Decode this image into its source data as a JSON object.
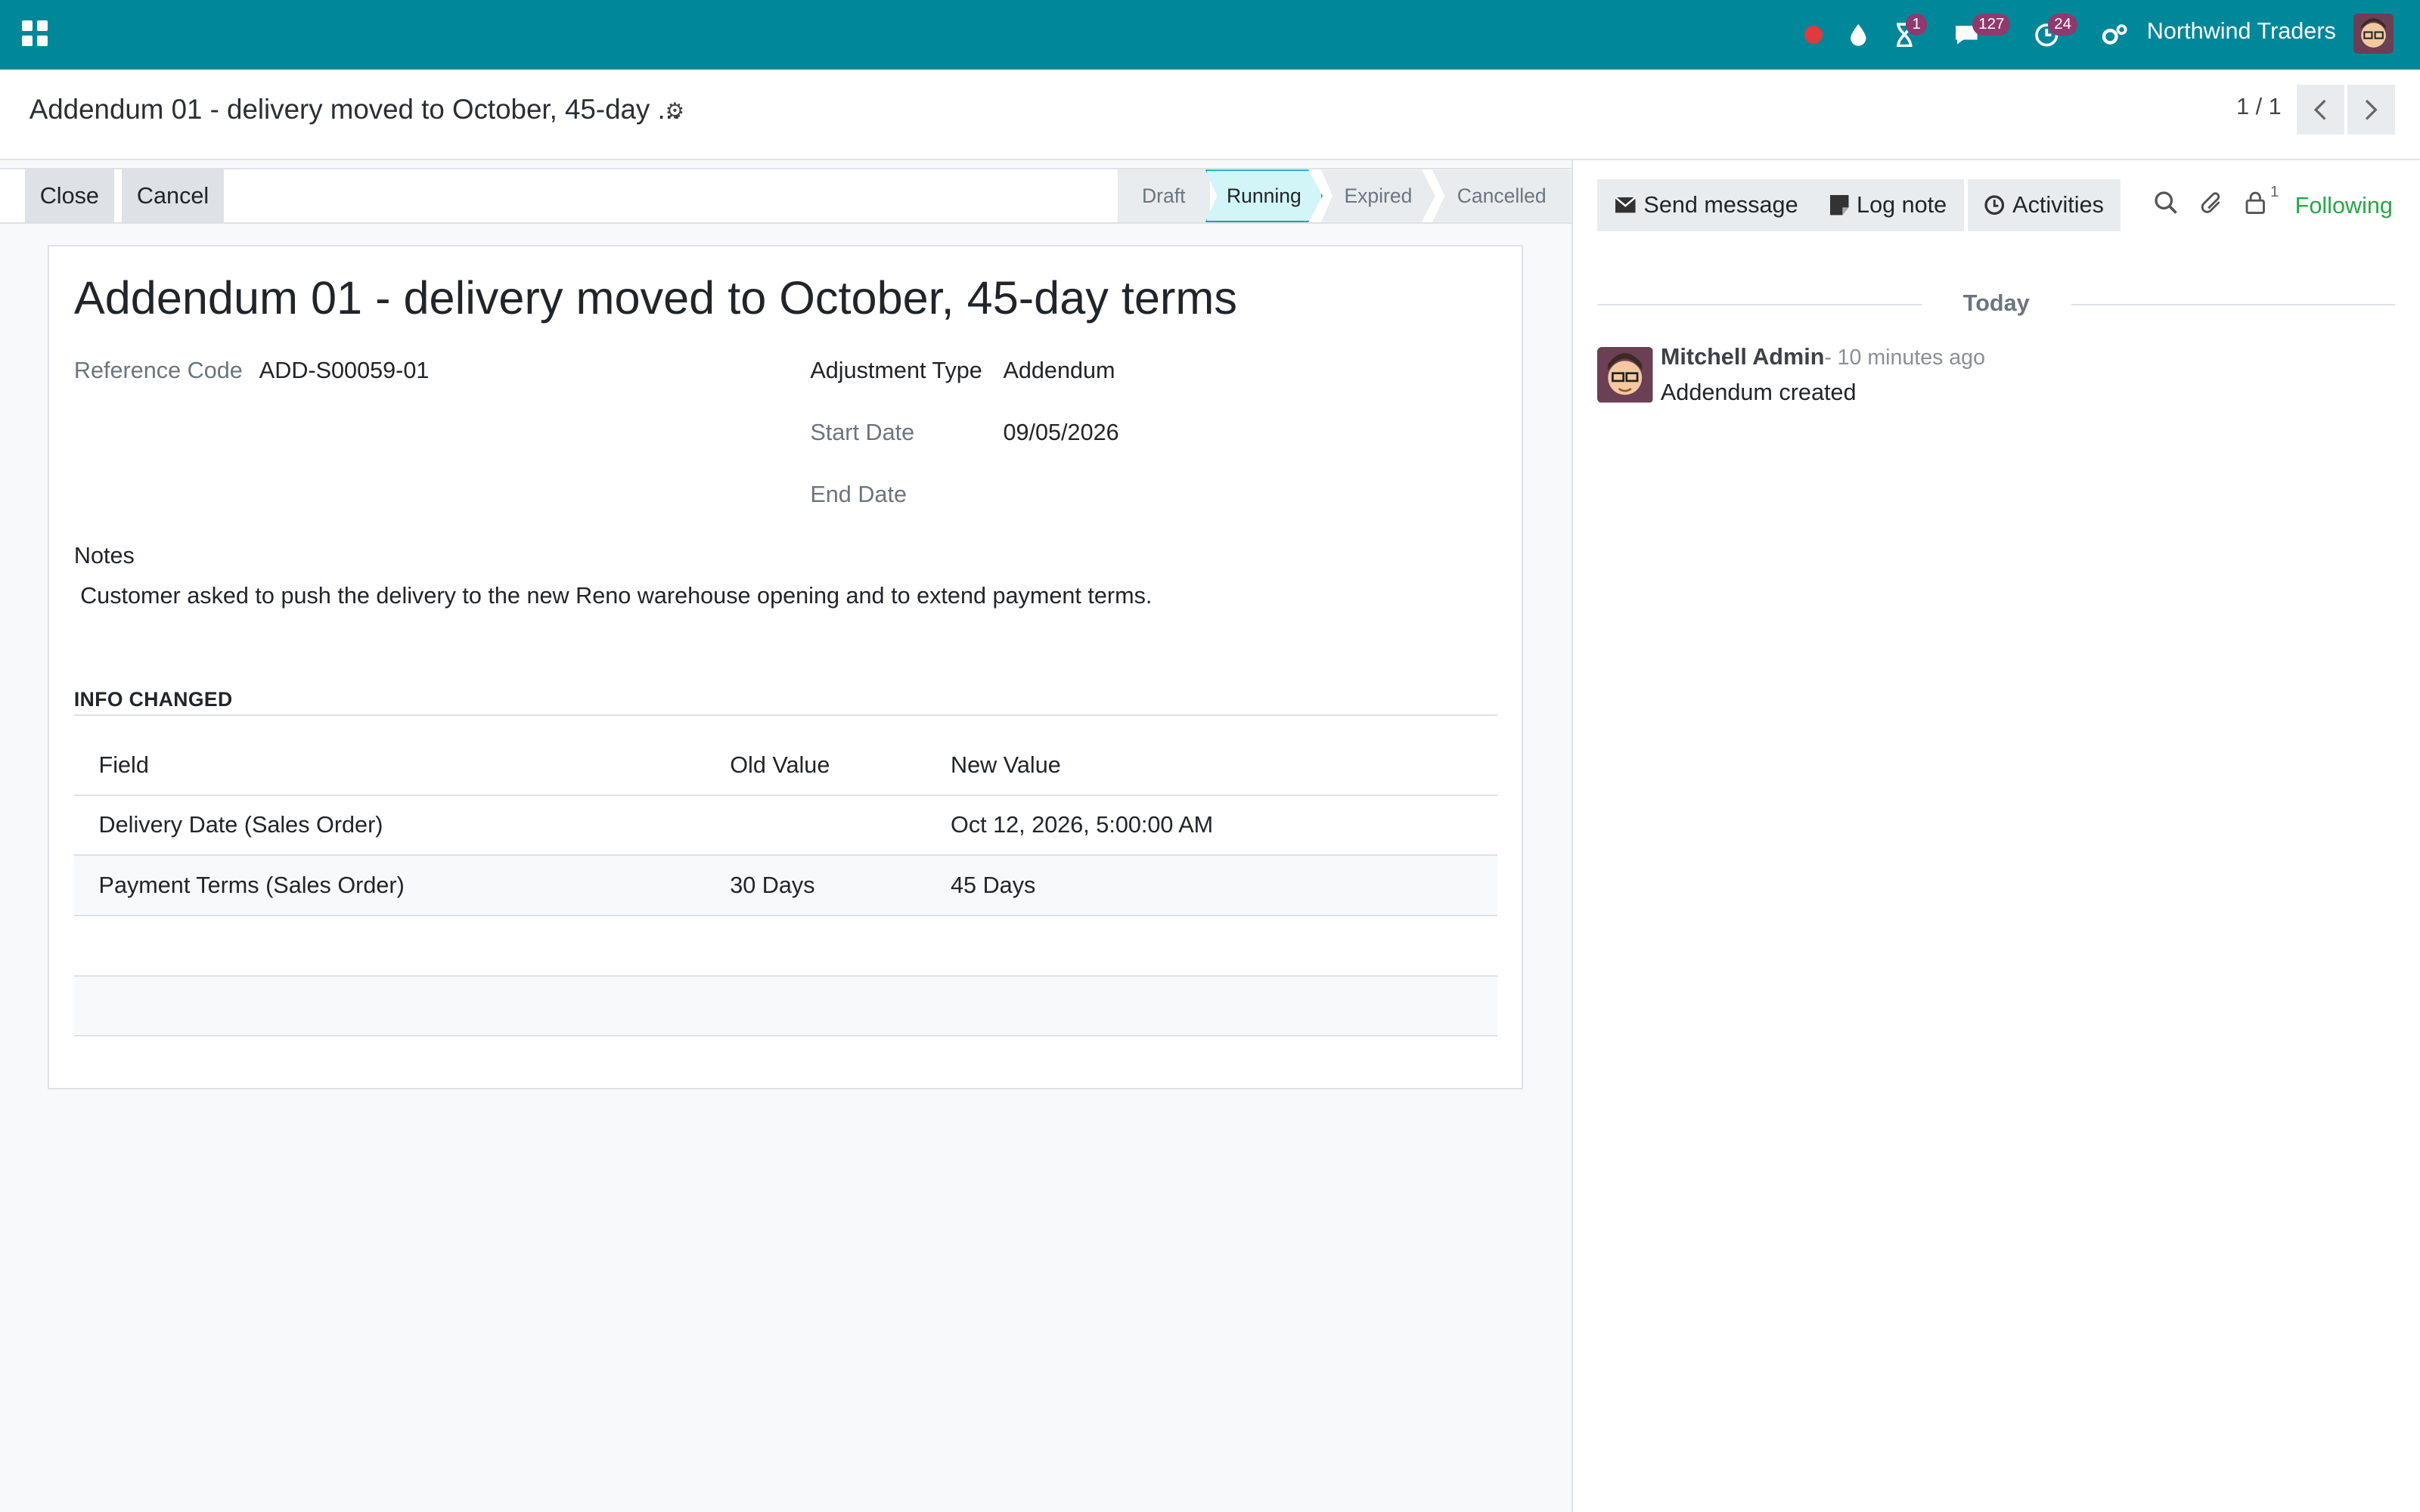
{
  "navbar": {
    "company": "Northwind Traders",
    "activity_badge": "1",
    "messages_badge": "127",
    "clock_badge": "24"
  },
  "control": {
    "breadcrumb": "Addendum 01 - delivery moved to October, 45-day ...",
    "pager": "1 / 1"
  },
  "statusbar": {
    "close_label": "Close",
    "cancel_label": "Cancel",
    "stages": [
      "Draft",
      "Running",
      "Expired",
      "Cancelled"
    ],
    "active_stage": "Running"
  },
  "form": {
    "title": "Addendum 01 - delivery moved to October, 45-day terms",
    "reference_code_label": "Reference Code",
    "reference_code": "ADD-S00059-01",
    "adjustment_type_label": "Adjustment Type",
    "adjustment_type": "Addendum",
    "start_date_label": "Start Date",
    "start_date": "09/05/2026",
    "end_date_label": "End Date",
    "end_date": "",
    "notes_label": "Notes",
    "notes": "Customer asked to push the delivery to the new Reno warehouse opening and to extend payment terms.",
    "section_title": "INFO CHANGED",
    "table": {
      "headers": [
        "Field",
        "Old Value",
        "New Value"
      ],
      "rows": [
        [
          "Delivery Date (Sales Order)",
          "",
          "Oct 12, 2026, 5:00:00 AM"
        ],
        [
          "Payment Terms (Sales Order)",
          "30 Days",
          "45 Days"
        ]
      ]
    }
  },
  "chatter": {
    "send_message": "Send message",
    "log_note": "Log note",
    "activities": "Activities",
    "followers_count": "1",
    "following": "Following",
    "date_separator": "Today",
    "message": {
      "author": "Mitchell Admin",
      "time": "- 10 minutes ago",
      "body": "Addendum created"
    }
  },
  "colors": {
    "navbar": "#00879a",
    "active_stage": "#d2f5f7",
    "following": "#28a745",
    "badge": "#8e3a6f"
  }
}
